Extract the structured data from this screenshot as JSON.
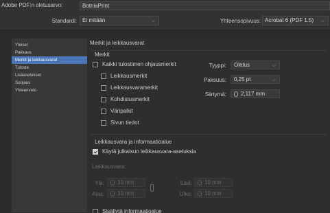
{
  "header": {
    "preset_label": "Adobe PDF:n oletusarvo:",
    "preset_value": "BotniaPrint",
    "standard_label": "Standardi:",
    "standard_value": "Ei mitään",
    "compat_label": "Yhteensopivuus:",
    "compat_value": "Acrobat 6 (PDF 1.5)"
  },
  "sidebar": {
    "items": [
      {
        "label": "Yleiset"
      },
      {
        "label": "Pakkaus"
      },
      {
        "label": "Merkit ja leikkausvarat"
      },
      {
        "label": "Tuloste"
      },
      {
        "label": "Lisäasetukset"
      },
      {
        "label": "Suojaus"
      },
      {
        "label": "Yhteenveto"
      }
    ],
    "selected_index": 2
  },
  "main": {
    "section_title": "Merkit ja leikkausvarat",
    "marks": {
      "title": "Merkit",
      "all_marks": "Kaikki tulostimen ohjausmerkit",
      "crop": "Leikkausmerkit",
      "bleed": "Leikkausvaramerkit",
      "registration": "Kohdistusmerkit",
      "color_bars": "Väripalkit",
      "page_info": "Sivun tiedot",
      "type_label": "Tyyppi:",
      "type_value": "Oletus",
      "weight_label": "Paksuus:",
      "weight_value": "0,25 pt",
      "offset_label": "Siirtymä:",
      "offset_value": "2,117 mm"
    },
    "bleed": {
      "title": "Leikkausvara ja informaatioalue",
      "use_doc": "Käytä julkaisun leikkausvara-asetuksia",
      "use_doc_checked": true,
      "bleed_label": "Leikkausvara:",
      "top_label": "Ylä:",
      "top_value": "10 mm",
      "bottom_label": "Alas:",
      "bottom_value": "10 mm",
      "inside_label": "Sisä:",
      "inside_value": "10 mm",
      "outside_label": "Ulko:",
      "outside_value": "10 mm",
      "slug": "Sisällytä informaatioalue"
    }
  }
}
